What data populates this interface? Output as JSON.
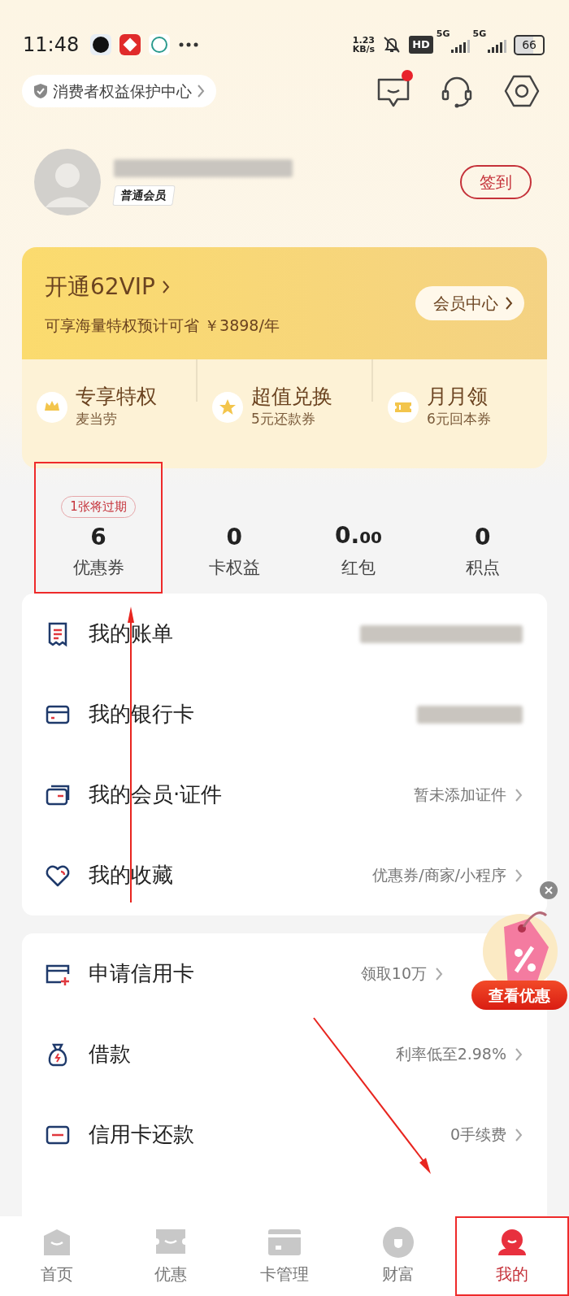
{
  "status_bar": {
    "time": "11:48",
    "net_speed_value": "1.23",
    "net_speed_unit": "KB/s",
    "hd_badge": "HD",
    "sim1": "5G",
    "sim2": "5G",
    "battery": "66"
  },
  "top_bar": {
    "protection_link": "消费者权益保护中心",
    "message_unread": true
  },
  "profile": {
    "level": "普通会员",
    "checkin": "签到"
  },
  "vip": {
    "title": "开通62VIP",
    "subtitle": "可享海量特权预计可省 ￥3898/年",
    "center_button": "会员中心",
    "perks": [
      {
        "kind": "crown",
        "title": "专享特权",
        "subtitle": "麦当劳"
      },
      {
        "kind": "star",
        "title": "超值兑换",
        "subtitle": "5元还款券"
      },
      {
        "kind": "ticket",
        "title": "月月领",
        "subtitle": "6元回本券"
      }
    ]
  },
  "stats": [
    {
      "value": "6",
      "label": "优惠券",
      "badge": "1张将过期",
      "highlighted": true
    },
    {
      "value": "0",
      "label": "卡权益",
      "highlighted": false
    },
    {
      "value": "0.",
      "value_small": "00",
      "label": "红包",
      "highlighted": false
    },
    {
      "value": "0",
      "label": "积点",
      "highlighted": false
    }
  ],
  "menu_groups": [
    [
      {
        "kind": "bill",
        "label": "我的账单",
        "redacted": true
      },
      {
        "kind": "card",
        "label": "我的银行卡",
        "redacted": true
      },
      {
        "kind": "cards",
        "label": "我的会员·证件",
        "detail": "暂未添加证件",
        "redacted": false
      },
      {
        "kind": "heart",
        "label": "我的收藏",
        "detail": "优惠券/商家/小程序",
        "redacted": false
      }
    ],
    [
      {
        "kind": "apply",
        "label": "申请信用卡",
        "detail": "领取10万",
        "redacted": false
      },
      {
        "kind": "bag",
        "label": "借款",
        "detail": "利率低至2.98%",
        "redacted": false
      },
      {
        "kind": "repay",
        "label": "信用卡还款",
        "detail": "0手续费",
        "redacted": false
      }
    ]
  ],
  "promo": {
    "button": "查看优惠"
  },
  "tabs": [
    {
      "kind": "home",
      "label": "首页",
      "selected": false,
      "highlighted": false
    },
    {
      "kind": "ticket",
      "label": "优惠",
      "selected": false,
      "highlighted": false
    },
    {
      "kind": "card",
      "label": "卡管理",
      "selected": false,
      "highlighted": false
    },
    {
      "kind": "coin",
      "label": "财富",
      "selected": false,
      "highlighted": false
    },
    {
      "kind": "person",
      "label": "我的",
      "selected": true,
      "highlighted": true
    }
  ]
}
